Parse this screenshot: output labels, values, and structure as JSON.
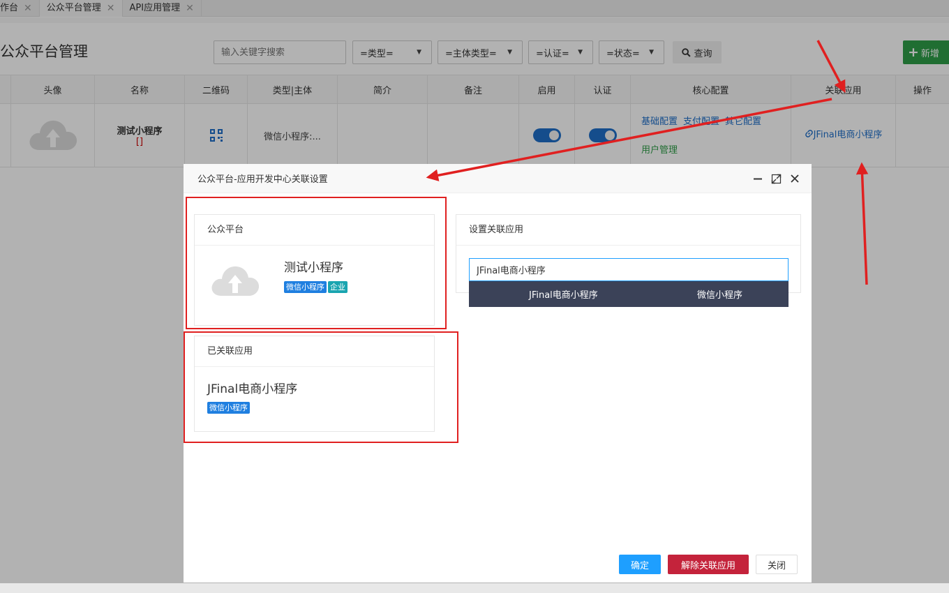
{
  "tabs": [
    {
      "label": "作台",
      "active": false
    },
    {
      "label": "公众平台管理",
      "active": true
    },
    {
      "label": "API应用管理",
      "active": false
    }
  ],
  "header": {
    "title": "公众平台管理",
    "search_placeholder": "输入关键字搜索",
    "filters": [
      "=类型=",
      "=主体类型=",
      "=认证=",
      "=状态="
    ],
    "query_label": "查询",
    "add_label": "新增"
  },
  "table": {
    "columns": [
      "头像",
      "名称",
      "二维码",
      "类型|主体",
      "简介",
      "备注",
      "启用",
      "认证",
      "核心配置",
      "关联应用",
      "操作"
    ],
    "row": {
      "name": "测试小程序",
      "name_suffix": "[]",
      "type": "微信小程序:...",
      "enabled": true,
      "certified": true,
      "core_links": [
        "基础配置",
        "支付配置",
        "其它配置"
      ],
      "user_link": "用户管理",
      "assoc_app": "JFinal电商小程序"
    }
  },
  "modal": {
    "title": "公众平台-应用开发中心关联设置",
    "platform_panel": {
      "header": "公众平台",
      "name": "测试小程序",
      "tags": [
        "微信小程序",
        "企业"
      ]
    },
    "linked_panel": {
      "header": "已关联应用",
      "name": "JFinal电商小程序",
      "tags": [
        "微信小程序"
      ]
    },
    "set_panel": {
      "header": "设置关联应用",
      "input_value": "JFinal电商小程序"
    },
    "dropdown": {
      "name": "JFinal电商小程序",
      "type": "微信小程序"
    },
    "buttons": {
      "confirm": "确定",
      "unlink": "解除关联应用",
      "close": "关闭"
    }
  },
  "colors": {
    "primary": "#1f6fc9",
    "success": "#2f9e48",
    "confirm": "#1e9fff",
    "danger": "#c4233b",
    "annotation": "#e02020"
  }
}
